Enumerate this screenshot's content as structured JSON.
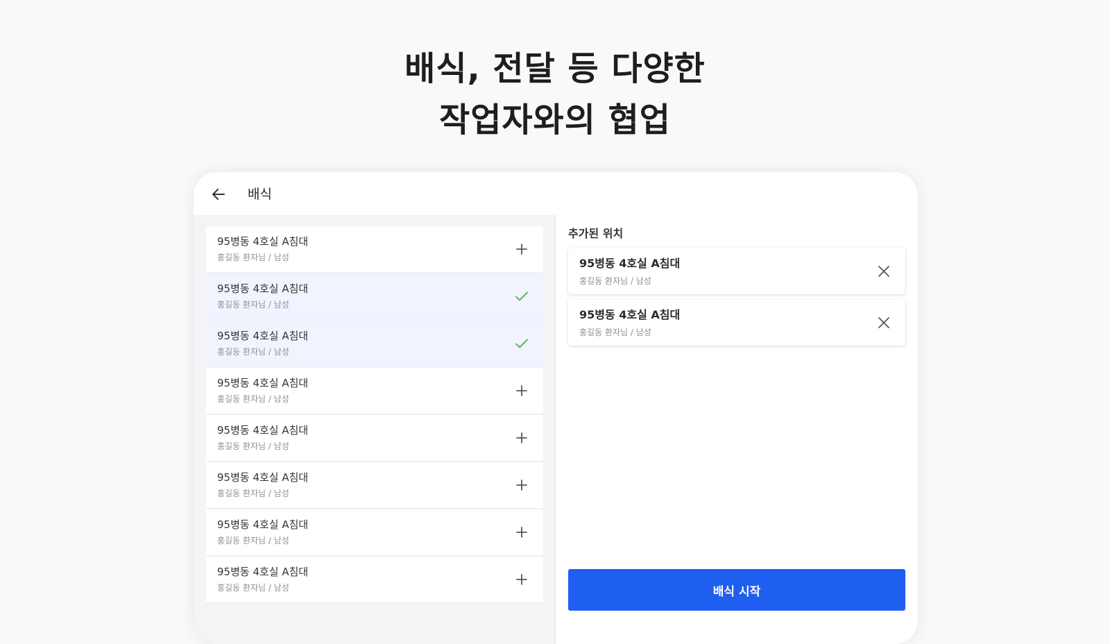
{
  "headline": {
    "line1": "배식, 전달 등 다양한",
    "line2": "작업자와의 협업"
  },
  "appbar": {
    "back_icon": "arrow-left-icon",
    "title": "배식"
  },
  "left_list": {
    "items": [
      {
        "title": "95병동 4호실 A침대",
        "subtitle": "홍길동 환자님 / 남성",
        "state": "add",
        "icon": "plus-icon"
      },
      {
        "title": "95병동 4호실 A침대",
        "subtitle": "홍길동 환자님 / 남성",
        "state": "selected",
        "icon": "check-icon"
      },
      {
        "title": "95병동 4호실 A침대",
        "subtitle": "홍길동 환자님 / 남성",
        "state": "selected",
        "icon": "check-icon"
      },
      {
        "title": "95병동 4호실 A침대",
        "subtitle": "홍길동 환자님 / 남성",
        "state": "add",
        "icon": "plus-icon"
      },
      {
        "title": "95병동 4호실 A침대",
        "subtitle": "홍길동 환자님 / 남성",
        "state": "add",
        "icon": "plus-icon"
      },
      {
        "title": "95병동 4호실 A침대",
        "subtitle": "홍길동 환자님 / 남성",
        "state": "add",
        "icon": "plus-icon"
      },
      {
        "title": "95병동 4호실 A침대",
        "subtitle": "홍길동 환자님 / 남성",
        "state": "add",
        "icon": "plus-icon"
      },
      {
        "title": "95병동 4호실 A침대",
        "subtitle": "홍길동 환자님 / 남성",
        "state": "add",
        "icon": "plus-icon"
      }
    ]
  },
  "right_panel": {
    "section_title": "추가된 위치",
    "added": [
      {
        "title": "95병동 4호실 A침대",
        "subtitle": "홍길동 환자님 / 남성",
        "icon": "close-icon"
      },
      {
        "title": "95병동 4호실 A침대",
        "subtitle": "홍길동 환자님 / 남성",
        "icon": "close-icon"
      }
    ],
    "start_button_label": "배식 시작"
  },
  "colors": {
    "accent": "#1f5ff0",
    "selected_bg": "#f1f4fe",
    "check": "#5cb85c",
    "page_bg": "#f9f9f9"
  }
}
